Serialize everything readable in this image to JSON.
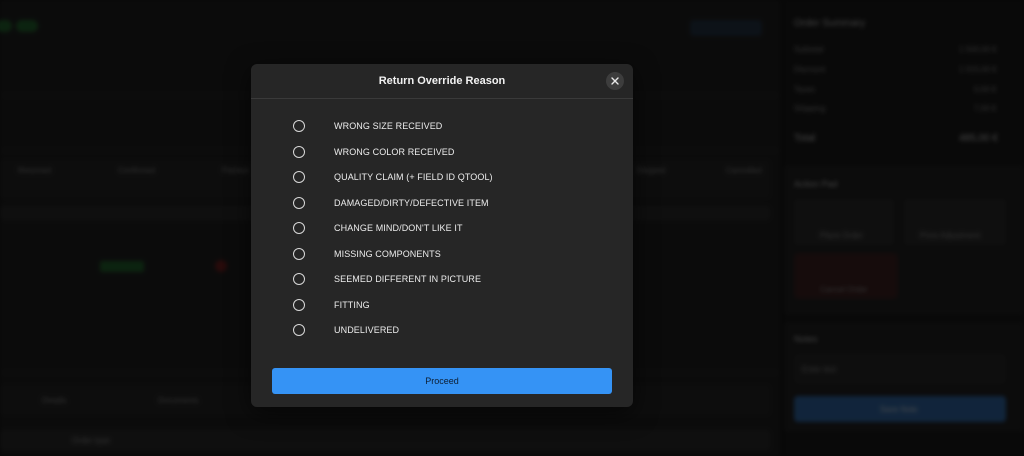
{
  "background": {
    "order_summary_title": "Order Summary",
    "summary_rows": [
      {
        "label": "Subtotal",
        "value": "1 500,00 €"
      },
      {
        "label": "Discount",
        "value": "1 015,00 €"
      },
      {
        "label": "Taxes",
        "value": "0,00 €"
      },
      {
        "label": "Shipping",
        "value": "7,00 €"
      }
    ],
    "total_label": "Total",
    "total_value": "485,00 €",
    "action_panel_title": "Action Pad",
    "actions": [
      "Place Order",
      "Price Adjustment",
      "Cancel Order"
    ],
    "notes_title": "Notes",
    "notes_placeholder": "Enter text",
    "save_note_label": "Save Note",
    "columns": [
      "Returned",
      "Confirmed",
      "Packed",
      "Shipped",
      "Cancelled"
    ],
    "tabs": [
      "Details",
      "Documents"
    ],
    "order_type_header": "Order type"
  },
  "modal": {
    "title": "Return Override Reason",
    "options": [
      "WRONG SIZE RECEIVED",
      "WRONG COLOR RECEIVED",
      "QUALITY CLAIM (+ FIELD ID QTOOL)",
      "DAMAGED/DIRTY/DEFECTIVE ITEM",
      "CHANGE MIND/DON'T LIKE IT",
      "MISSING COMPONENTS",
      "SEEMED DIFFERENT IN PICTURE",
      "FITTING",
      "UNDELIVERED"
    ],
    "proceed_label": "Proceed"
  },
  "colors": {
    "accent": "#3593f5",
    "modal_bg": "#262626",
    "page_bg": "#0f0f0f"
  }
}
